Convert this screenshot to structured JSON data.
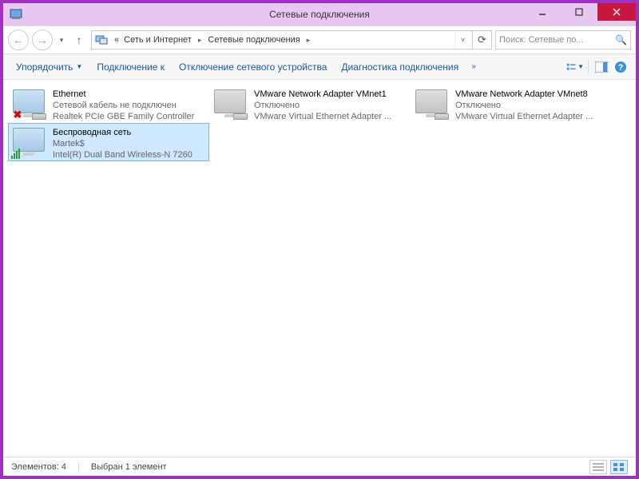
{
  "window": {
    "title": "Сетевые подключения"
  },
  "breadcrumb": {
    "prefix": "«",
    "item1": "Сеть и Интернет",
    "item2": "Сетевые подключения"
  },
  "search": {
    "placeholder": "Поиск: Сетевые по..."
  },
  "commands": {
    "organize": "Упорядочить",
    "connect": "Подключение к",
    "disable": "Отключение сетевого устройства",
    "diagnose": "Диагностика подключения"
  },
  "items": [
    {
      "name": "Ethernet",
      "line2": "Сетевой кабель не подключен",
      "line3": "Realtek PCIe GBE Family Controller",
      "status": "disconnected"
    },
    {
      "name": "VMware Network Adapter VMnet1",
      "line2": "Отключено",
      "line3": "VMware Virtual Ethernet Adapter ...",
      "status": "disabled"
    },
    {
      "name": "VMware Network Adapter VMnet8",
      "line2": "Отключено",
      "line3": "VMware Virtual Ethernet Adapter ...",
      "status": "disabled"
    },
    {
      "name": "Беспроводная сеть",
      "line2": "Martek$",
      "line3": "Intel(R) Dual Band Wireless-N 7260",
      "status": "wifi",
      "selected": true
    }
  ],
  "status": {
    "count": "Элементов: 4",
    "selected": "Выбран 1 элемент"
  }
}
